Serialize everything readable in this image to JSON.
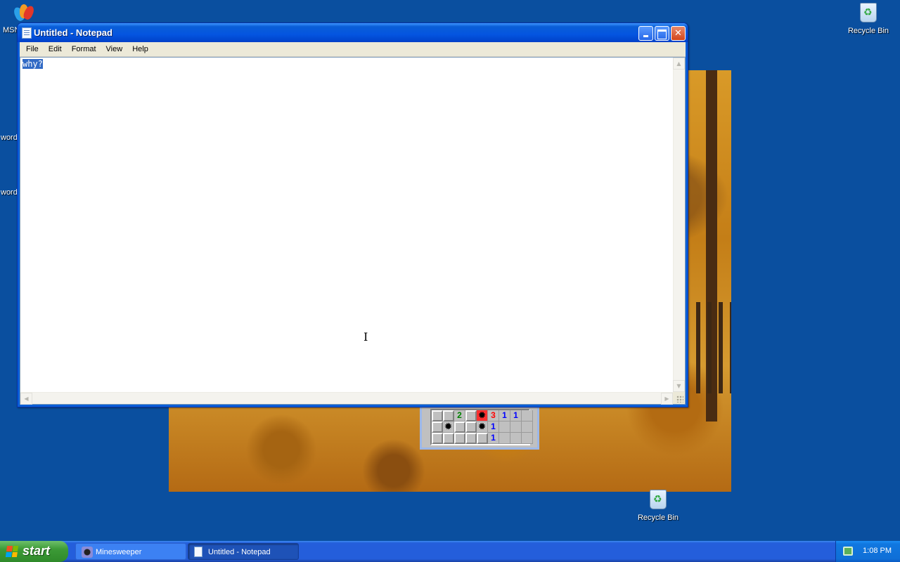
{
  "desktop": {
    "icons": [
      {
        "label": "MSN",
        "icon": "msn-butterfly-icon"
      },
      {
        "label": "word",
        "icon": "word-doc-icon"
      },
      {
        "label": "word",
        "icon": "word-doc-icon"
      },
      {
        "label": "Recycle Bin",
        "icon": "recycle-bin-icon"
      },
      {
        "label": "Recycle Bin",
        "icon": "recycle-bin-icon"
      }
    ]
  },
  "minesweeper": {
    "rows": [
      [
        "",
        "",
        "2",
        "",
        "mine-hit",
        "3",
        "1",
        "1",
        "",
        ""
      ],
      [
        "",
        "mine",
        "",
        "",
        "mine",
        "1",
        "",
        "",
        "",
        ""
      ],
      [
        "",
        "",
        "",
        "",
        "",
        "1",
        "",
        "",
        "",
        ""
      ]
    ]
  },
  "notepad": {
    "title": "Untitled - Notepad",
    "menu": [
      "File",
      "Edit",
      "Format",
      "View",
      "Help"
    ],
    "content": "why?",
    "content_selected": true
  },
  "taskbar": {
    "start_label": "start",
    "tasks": [
      {
        "label": "Minesweeper",
        "icon": "minesweeper-icon",
        "active": false
      },
      {
        "label": "Untitled - Notepad",
        "icon": "notepad-icon",
        "active": true
      }
    ],
    "clock": "1:08 PM"
  },
  "colors": {
    "desktop": "#0a4f9f",
    "titlebar": "#0a5ed7",
    "selection": "#316ac5",
    "start_button": "#3c9a36"
  }
}
